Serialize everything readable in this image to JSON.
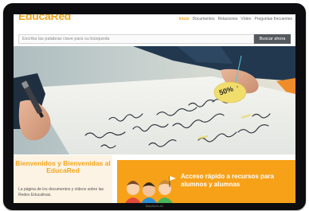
{
  "device": {
    "label": "MacBook Air"
  },
  "header": {
    "logo": "EducaRed",
    "nav": [
      "Inicio",
      "Documentos",
      "Relaciones",
      "Vídeo",
      "Preguntas frecuentes"
    ]
  },
  "search": {
    "placeholder": "Escriba las palabras clave para su búsqueda",
    "button_label": "Buscar ahora"
  },
  "hero": {
    "tag_text": "50%"
  },
  "welcome": {
    "title": "Bienvenidos y Bienvenidas al EducaRed",
    "text": "La página de los documentos y vídeos sobre las Redes Educativas."
  },
  "quick_access": {
    "text": "Acceso rápido a recursos para alumnos y alumnas"
  },
  "colors": {
    "accent": "#f4a51c",
    "banner": "#f7a119",
    "button": "#555a5f"
  }
}
